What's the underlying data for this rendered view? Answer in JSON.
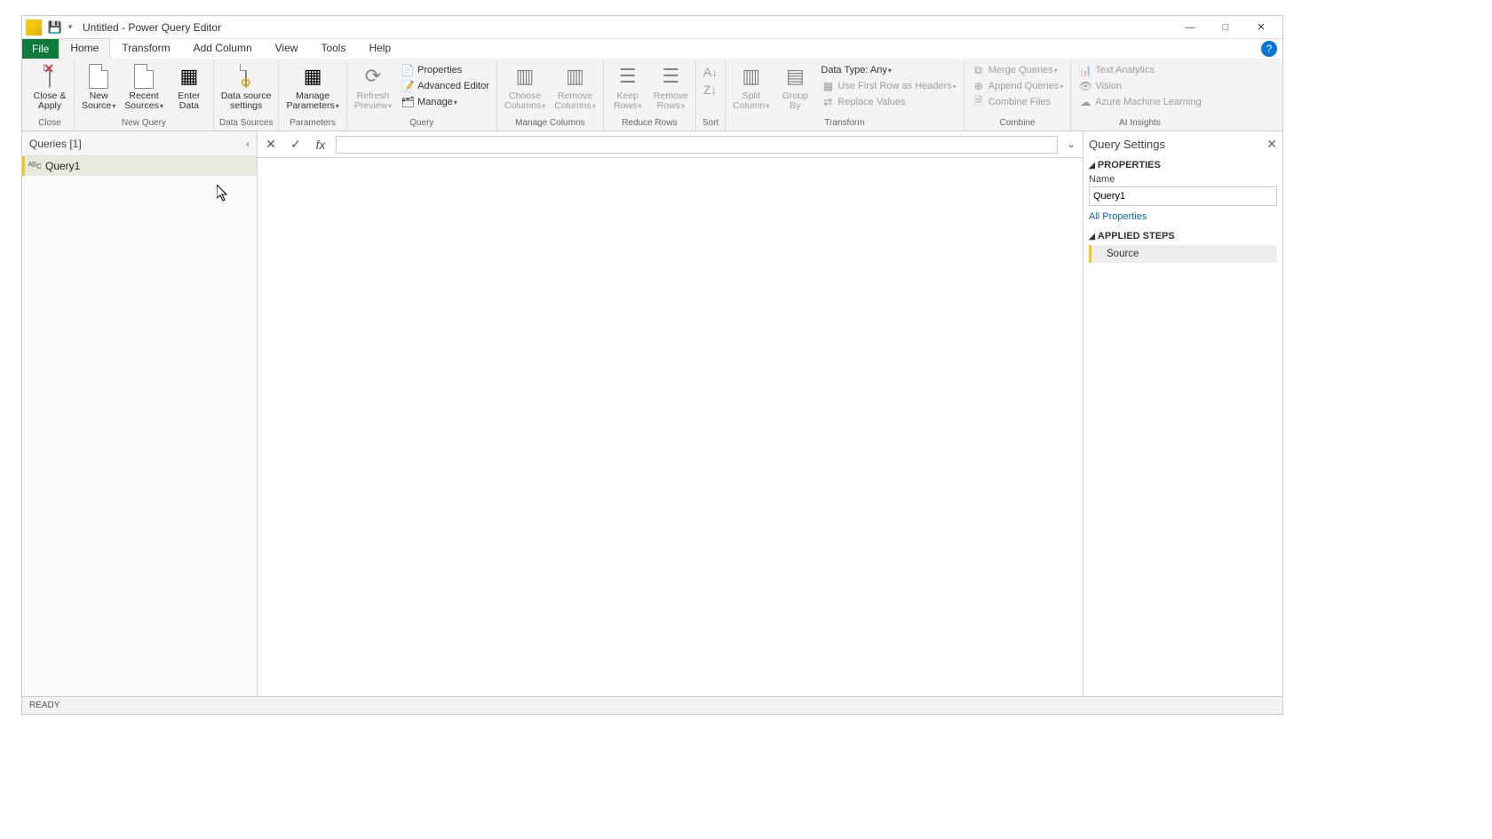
{
  "window": {
    "title": "Untitled - Power Query Editor"
  },
  "tabs": {
    "file": "File",
    "home": "Home",
    "transform": "Transform",
    "addColumn": "Add Column",
    "view": "View",
    "tools": "Tools",
    "help": "Help"
  },
  "ribbon": {
    "close": {
      "closeApply": "Close &\nApply",
      "group": "Close"
    },
    "newQuery": {
      "newSource": "New\nSource",
      "recentSources": "Recent\nSources",
      "enterData": "Enter\nData",
      "group": "New Query"
    },
    "dataSources": {
      "settings": "Data source\nsettings",
      "group": "Data Sources"
    },
    "parameters": {
      "manage": "Manage\nParameters",
      "group": "Parameters"
    },
    "query": {
      "refresh": "Refresh\nPreview",
      "properties": "Properties",
      "advanced": "Advanced Editor",
      "manage": "Manage",
      "group": "Query"
    },
    "manageCols": {
      "choose": "Choose\nColumns",
      "remove": "Remove\nColumns",
      "group": "Manage Columns"
    },
    "reduceRows": {
      "keep": "Keep\nRows",
      "remove": "Remove\nRows",
      "group": "Reduce Rows"
    },
    "sort": {
      "group": "Sort"
    },
    "transform": {
      "split": "Split\nColumn",
      "groupBy": "Group\nBy",
      "dataType": "Data Type: Any",
      "firstRow": "Use First Row as Headers",
      "replace": "Replace Values",
      "group": "Transform"
    },
    "combine": {
      "merge": "Merge Queries",
      "append": "Append Queries",
      "combineFiles": "Combine Files",
      "group": "Combine"
    },
    "ai": {
      "textAnalytics": "Text Analytics",
      "vision": "Vision",
      "aml": "Azure Machine Learning",
      "group": "AI Insights"
    }
  },
  "queriesPane": {
    "header": "Queries [1]",
    "items": [
      {
        "name": "Query1"
      }
    ]
  },
  "formulaBar": {
    "value": ""
  },
  "settings": {
    "title": "Query Settings",
    "propertiesHeader": "PROPERTIES",
    "nameLabel": "Name",
    "nameValue": "Query1",
    "allProps": "All Properties",
    "stepsHeader": "APPLIED STEPS",
    "steps": [
      {
        "name": "Source"
      }
    ]
  },
  "status": "READY"
}
